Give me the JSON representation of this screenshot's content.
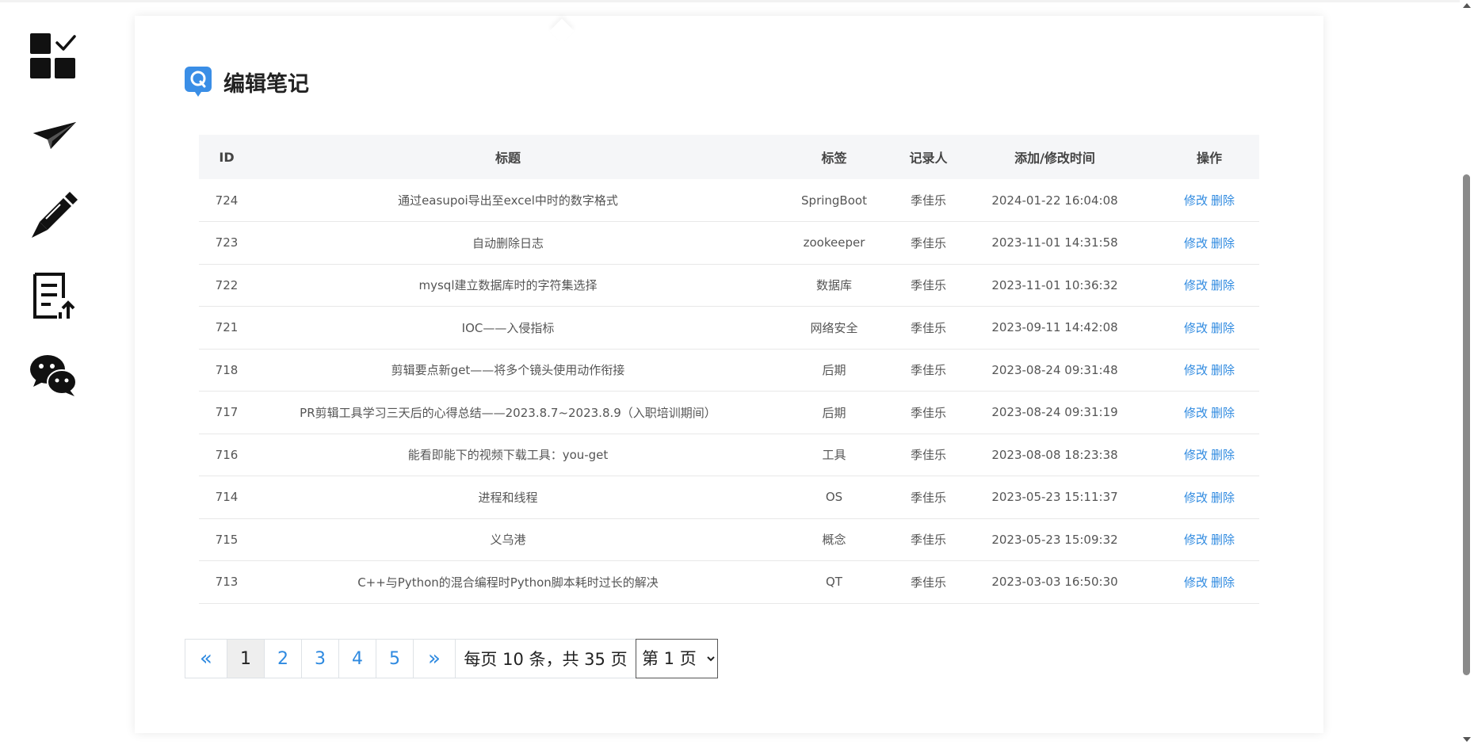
{
  "sidebar": {
    "icons": [
      {
        "name": "dashboard-icon"
      },
      {
        "name": "paper-plane-icon"
      },
      {
        "name": "pen-icon"
      },
      {
        "name": "document-upload-icon"
      },
      {
        "name": "wechat-icon"
      }
    ]
  },
  "page": {
    "title": "编辑笔记",
    "title_icon": "qq-logo-icon"
  },
  "table": {
    "headers": [
      "ID",
      "标题",
      "标签",
      "记录人",
      "添加/修改时间",
      "操作"
    ],
    "rows": [
      {
        "id": "724",
        "title": "通过easupoi导出至excel中时的数字格式",
        "tag": "SpringBoot",
        "user": "季佳乐",
        "time": "2024-01-22 16:04:08"
      },
      {
        "id": "723",
        "title": "自动删除日志",
        "tag": "zookeeper",
        "user": "季佳乐",
        "time": "2023-11-01 14:31:58"
      },
      {
        "id": "722",
        "title": "mysql建立数据库时的字符集选择",
        "tag": "数据库",
        "user": "季佳乐",
        "time": "2023-11-01 10:36:32"
      },
      {
        "id": "721",
        "title": "IOC——入侵指标",
        "tag": "网络安全",
        "user": "季佳乐",
        "time": "2023-09-11 14:42:08"
      },
      {
        "id": "718",
        "title": "剪辑要点新get——将多个镜头使用动作衔接",
        "tag": "后期",
        "user": "季佳乐",
        "time": "2023-08-24 09:31:48"
      },
      {
        "id": "717",
        "title": "PR剪辑工具学习三天后的心得总结——2023.8.7~2023.8.9（入职培训期间）",
        "tag": "后期",
        "user": "季佳乐",
        "time": "2023-08-24 09:31:19"
      },
      {
        "id": "716",
        "title": "能看即能下的视频下载工具：you-get",
        "tag": "工具",
        "user": "季佳乐",
        "time": "2023-08-08 18:23:38"
      },
      {
        "id": "714",
        "title": "进程和线程",
        "tag": "OS",
        "user": "季佳乐",
        "time": "2023-05-23 15:11:37"
      },
      {
        "id": "715",
        "title": "义乌港",
        "tag": "概念",
        "user": "季佳乐",
        "time": "2023-05-23 15:09:32"
      },
      {
        "id": "713",
        "title": "C++与Python的混合编程时Python脚本耗时过长的解决",
        "tag": "QT",
        "user": "季佳乐",
        "time": "2023-03-03 16:50:30"
      }
    ],
    "edit_label": "修改",
    "delete_label": "删除"
  },
  "pagination": {
    "prev": "«",
    "pages": [
      "1",
      "2",
      "3",
      "4",
      "5"
    ],
    "active_page": "1",
    "next": "»",
    "info": "每页 10 条，共 35 页",
    "select_value": "第 1 页"
  },
  "colors": {
    "link": "#2f8ae0",
    "header_bg": "#f5f6f8",
    "logo_blue": "#3a8ee6"
  }
}
